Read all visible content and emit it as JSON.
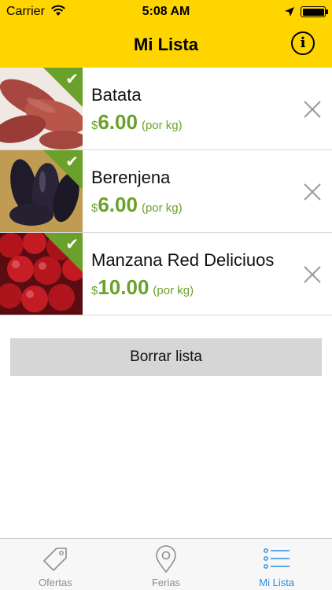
{
  "status_bar": {
    "carrier": "Carrier",
    "time": "5:08 AM"
  },
  "nav": {
    "title": "Mi Lista",
    "info_icon": "info-circle-icon"
  },
  "colors": {
    "header": "#FFD500",
    "price_green": "#6aa12a",
    "tab_active": "#2a8be6",
    "tab_inactive": "#8e8e93"
  },
  "items": [
    {
      "name": "Batata",
      "currency": "$",
      "price": "6.00",
      "unit": "(por kg)",
      "checked": true
    },
    {
      "name": "Berenjena",
      "currency": "$",
      "price": "6.00",
      "unit": "(por kg)",
      "checked": true
    },
    {
      "name": "Manzana Red Deliciuos",
      "currency": "$",
      "price": "10.00",
      "unit": "(por kg)",
      "checked": true
    }
  ],
  "clear_button": {
    "label": "Borrar lista"
  },
  "tabs": [
    {
      "label": "Ofertas",
      "icon": "tag-icon",
      "active": false
    },
    {
      "label": "Ferias",
      "icon": "map-pin-icon",
      "active": false
    },
    {
      "label": "Mi Lista",
      "icon": "list-icon",
      "active": true
    }
  ]
}
